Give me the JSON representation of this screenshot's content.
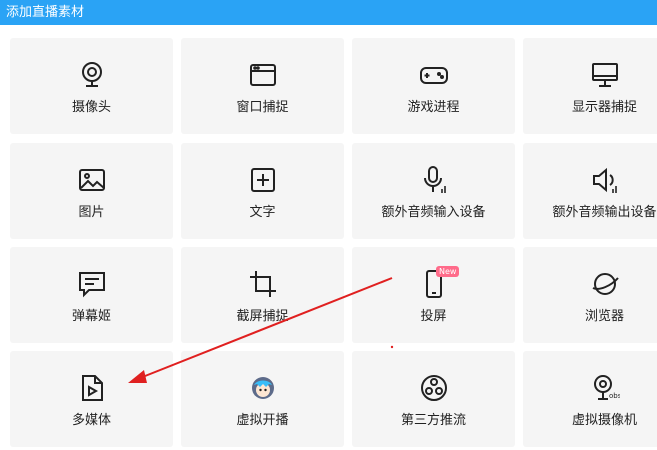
{
  "title": "添加直播素材",
  "tiles": [
    {
      "label": "摄像头",
      "icon": "webcam-icon"
    },
    {
      "label": "窗口捕捉",
      "icon": "window-icon"
    },
    {
      "label": "游戏进程",
      "icon": "gamepad-icon"
    },
    {
      "label": "显示器捕捉",
      "icon": "monitor-icon"
    },
    {
      "label": "图片",
      "icon": "image-icon"
    },
    {
      "label": "文字",
      "icon": "text-plus-icon"
    },
    {
      "label": "额外音频输入设备",
      "icon": "microphone-icon"
    },
    {
      "label": "额外音频输出设备",
      "icon": "speaker-icon"
    },
    {
      "label": "弹幕姬",
      "icon": "chat-bubble-icon"
    },
    {
      "label": "截屏捕捉",
      "icon": "crop-icon"
    },
    {
      "label": "投屏",
      "icon": "phone-icon",
      "badge": "New"
    },
    {
      "label": "浏览器",
      "icon": "planet-icon"
    },
    {
      "label": "多媒体",
      "icon": "media-file-icon"
    },
    {
      "label": "虚拟开播",
      "icon": "anime-avatar-icon"
    },
    {
      "label": "第三方推流",
      "icon": "obs-logo-icon"
    },
    {
      "label": "虚拟摄像机",
      "icon": "obs-camera-icon"
    }
  ],
  "colors": {
    "titlebar": "#2aa3f5",
    "tile": "#f5f5f5",
    "annotation_arrow": "#e02020",
    "badge": "#ff6b8a"
  }
}
